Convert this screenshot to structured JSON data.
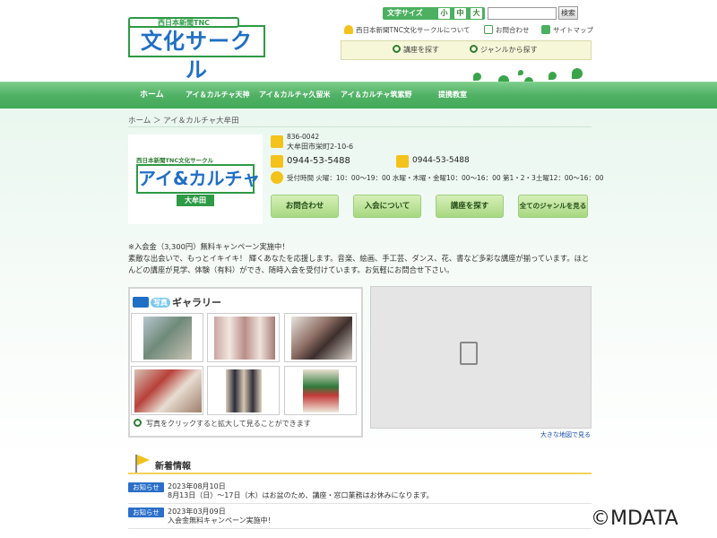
{
  "header": {
    "logo_top": "西日本新聞TNC",
    "logo_main": "文化サークル",
    "font_size_label": "文字サイズ",
    "font_sizes": [
      "小",
      "中",
      "大"
    ],
    "search_placeholder": "",
    "search_button": "検索",
    "links": {
      "about": "西日本新聞TNC文化サークルについて",
      "contact": "お問合わせ",
      "sitemap": "サイトマップ"
    },
    "finder": {
      "course": "講座を探す",
      "genre": "ジャンルから探す"
    }
  },
  "nav": {
    "items": [
      "ホーム",
      "アイ＆カルチャ天神",
      "アイ＆カルチャ久留米",
      "アイ＆カルチャ筑紫野",
      "提携教室"
    ]
  },
  "breadcrumb": {
    "home": "ホーム",
    "separator": "＞",
    "current": "アイ＆カルチャ大牟田"
  },
  "school": {
    "logo_sub": "西日本新聞TNC文化サークル",
    "logo_main": "アイ&カルチャ",
    "logo_tag": "大牟田",
    "postal": "836-0042",
    "address": "大牟田市栄町2-10-6",
    "tel": "0944-53-5488",
    "fax": "0944-53-5488",
    "hours": "受付時間 火曜：10：00～19：00 水曜・木曜・金曜10：00～16：00 第1・2・3土曜12：00～16：00",
    "buttons": [
      "お問合わせ",
      "入会について",
      "講座を探す",
      "全てのジャンルを見る"
    ]
  },
  "notice": {
    "line1": "※入会金（3,300円）無料キャンペーン実施中！",
    "body": "素敵な出会いで、もっとイキイキ！ 輝くあなたを応援します。音楽、絵画、手工芸、ダンス、花、書など多彩な講座が揃っています。ほとんどの講座が見学、体験（有料）ができ、随時入会を受付けています。お気軽にお問合せ下さい。"
  },
  "gallery": {
    "badge": "写真",
    "title": "ギャラリー",
    "note": "写真をクリックすると拡大して見ることができます"
  },
  "map": {
    "link": "大きな地図で見る"
  },
  "news": {
    "title": "新着情報",
    "items": [
      {
        "badge": "お知らせ",
        "date": "2023年08月10日",
        "text": "8月13日（日）～17日（木）はお盆のため、講座・窓口業務はお休みになります。"
      },
      {
        "badge": "お知らせ",
        "date": "2023年03月09日",
        "text": "入会金無料キャンペーン実施中！"
      }
    ]
  },
  "watermark": "©MDATA",
  "colors": {
    "nav_green": "#4fb164",
    "brand_green": "#2e9a45",
    "logo_blue": "#1f6fc6",
    "badge_blue": "#2a6fc9",
    "accent_yellow": "#f3c21b"
  }
}
